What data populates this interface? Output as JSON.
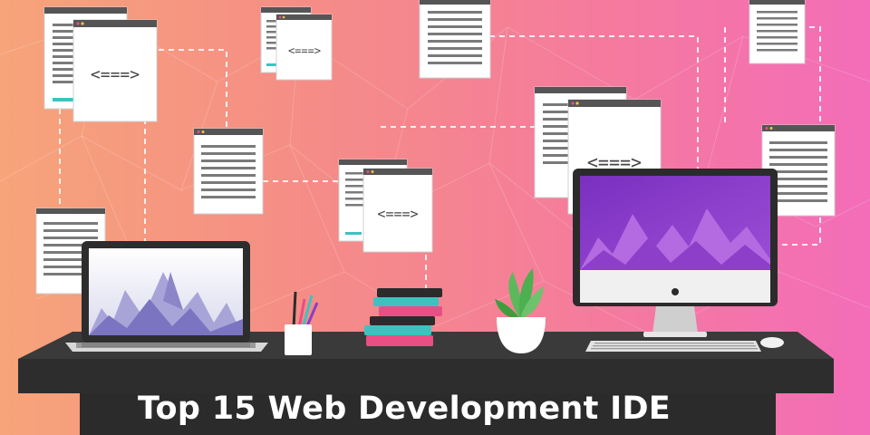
{
  "banner": {
    "title": "Top 15 Web Development IDE"
  },
  "colors": {
    "background_left": "#f7a47a",
    "background_right": "#f36db8",
    "desk": "#2b2b2b",
    "monitor_screen": "#8a3fc9",
    "laptop_screen": "#e8e8f6",
    "book_teal": "#3fc1c0",
    "book_pink": "#e94f84",
    "plant_green": "#5cb85c"
  },
  "icons": {
    "code_symbol": "<===>"
  }
}
